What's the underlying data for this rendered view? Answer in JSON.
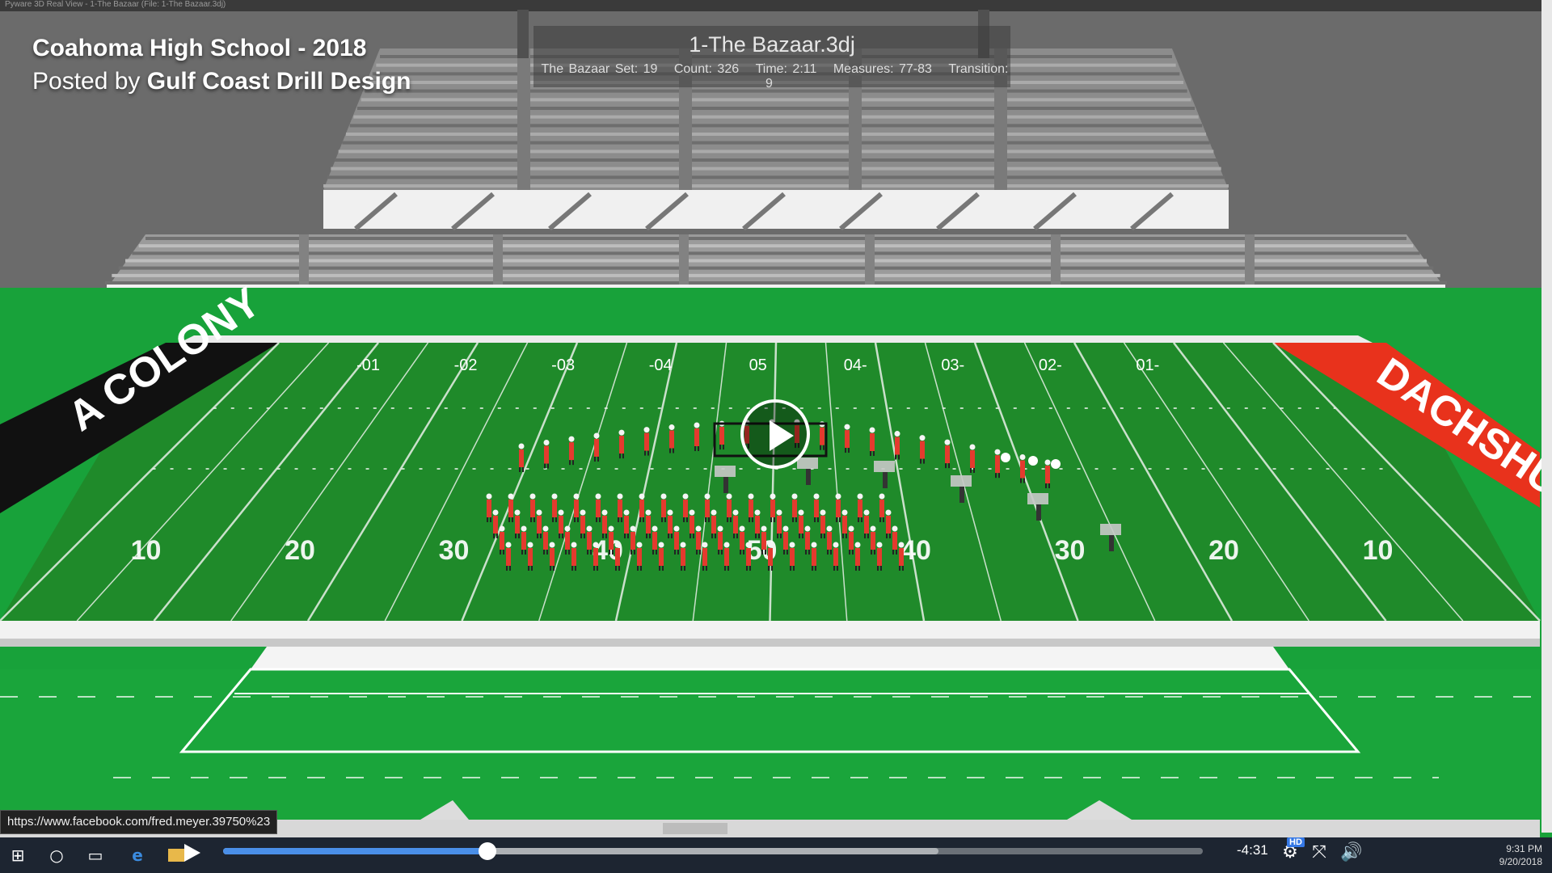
{
  "window": {
    "title": "Pyware 3D Real View - 1-The Bazaar (File: 1-The Bazaar.3dj)"
  },
  "video_overlay": {
    "title": "Coahoma High School - 2018",
    "posted_prefix": "Posted by",
    "posted_by": "Gulf Coast Drill Design"
  },
  "drill_info": {
    "file": "1-The Bazaar.3dj",
    "set": "The Bazaar Set: 19",
    "count": "Count: 326",
    "time": "Time: 2:11",
    "measures": "Measures: 77-83",
    "transition": "Transition: 9"
  },
  "field": {
    "endzone_left": "A COLONY",
    "endzone_right": "DACHSHU",
    "endzone_left_color": "#111111",
    "endzone_right_color": "#e8321c",
    "turf_color": "#1f8a2a",
    "far_numbers": [
      "-01",
      "-02",
      "-03",
      "-04",
      "05",
      "04-",
      "03-",
      "02-",
      "01-"
    ],
    "near_numbers": [
      "10",
      "20",
      "30",
      "40",
      "50",
      "40",
      "30",
      "20",
      "10"
    ]
  },
  "link_tooltip": "https://www.facebook.com/fred.meyer.39750%23",
  "player": {
    "time_remaining": "-4:31",
    "progress": 0.27,
    "buffered": 0.73,
    "hd_label": "HD",
    "accent_color": "#4a8fe8"
  },
  "clock": {
    "time": "9:31 PM",
    "date": "9/20/2018"
  },
  "icons": {
    "windows": "⊞",
    "search": "○",
    "task_view": "▭",
    "settings": "⚙",
    "fullscreen": "⤧",
    "volume": "🔊"
  }
}
